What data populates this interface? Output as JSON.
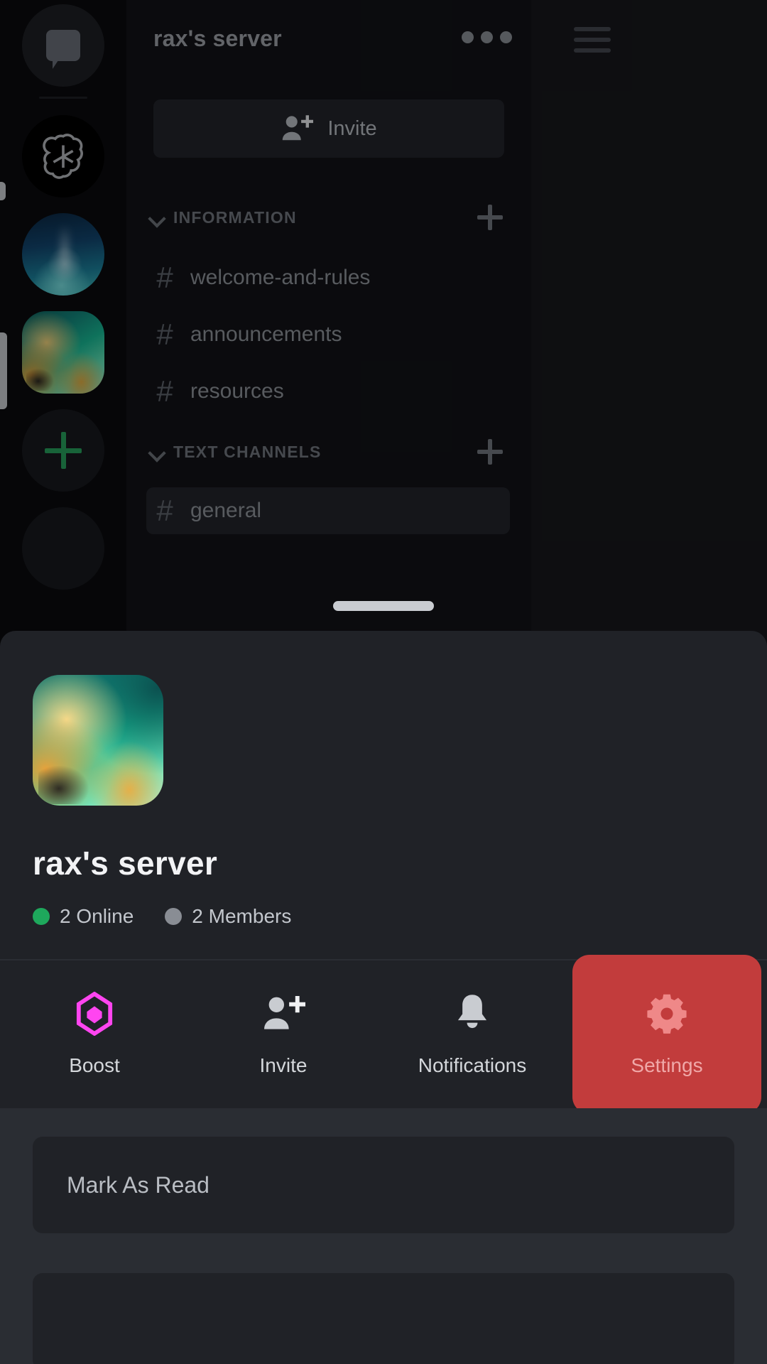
{
  "rail": {
    "items": [
      {
        "name": "direct-messages",
        "icon": "chat-bubble-icon",
        "label": "Direct Messages"
      },
      {
        "name": "openai-server",
        "icon": "openai-logo-icon",
        "label": "OpenAI"
      },
      {
        "name": "night-server",
        "icon": "server-avatar",
        "label": "Server"
      },
      {
        "name": "rax-server",
        "icon": "server-avatar",
        "label": "rax's server",
        "selected": true
      },
      {
        "name": "add-server",
        "icon": "plus-icon",
        "label": "Add a Server"
      }
    ]
  },
  "sidebar": {
    "server_title": "rax's server",
    "overflow_label": "More Options",
    "invite_label": "Invite",
    "sections": [
      {
        "title": "INFORMATION",
        "channels": [
          {
            "name": "welcome-and-rules",
            "active": false
          },
          {
            "name": "announcements",
            "active": false
          },
          {
            "name": "resources",
            "active": false
          }
        ]
      },
      {
        "title": "TEXT CHANNELS",
        "channels": [
          {
            "name": "general",
            "active": true
          }
        ]
      }
    ]
  },
  "sheet": {
    "server_name": "rax's server",
    "stats": [
      {
        "label": "2 Online",
        "color": "#1ea85c"
      },
      {
        "label": "2 Members",
        "color": "#898d94"
      }
    ],
    "actions": [
      {
        "label": "Boost",
        "icon": "boost-gem-icon",
        "highlighted": false
      },
      {
        "label": "Invite",
        "icon": "person-add-icon",
        "highlighted": false
      },
      {
        "label": "Notifications",
        "icon": "bell-icon",
        "highlighted": false
      },
      {
        "label": "Settings",
        "icon": "gear-icon",
        "highlighted": true
      }
    ],
    "rows": [
      {
        "label": "Mark As Read"
      },
      {
        "label": ""
      }
    ]
  },
  "colors": {
    "accent_red": "#c23c3c",
    "boost_pink": "#ff45f0",
    "online_green": "#1ea85c",
    "sheet_bg": "#202227",
    "list_bg": "#2a2d33"
  }
}
